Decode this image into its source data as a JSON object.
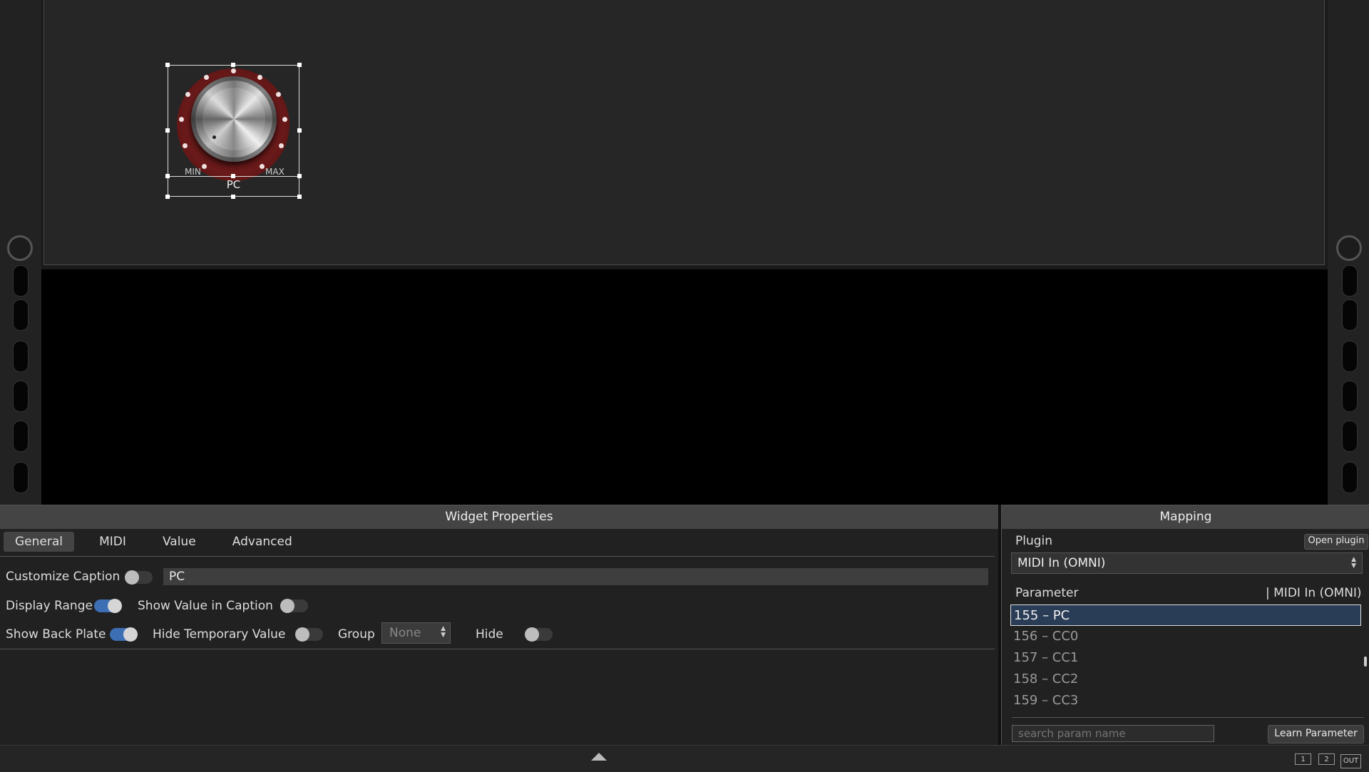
{
  "knob_widget": {
    "min_label": "MIN",
    "max_label": "MAX",
    "caption": "PC"
  },
  "widget_properties": {
    "title": "Widget Properties",
    "tabs": [
      "General",
      "MIDI",
      "Value",
      "Advanced"
    ],
    "active_tab": "General",
    "customize_caption_label": "Customize Caption",
    "customize_caption_on": false,
    "caption_value": "PC",
    "display_range_label": "Display Range",
    "display_range_on": true,
    "show_value_in_caption_label": "Show Value in Caption",
    "show_value_in_caption_on": false,
    "show_back_plate_label": "Show Back Plate",
    "show_back_plate_on": true,
    "hide_temporary_value_label": "Hide Temporary Value",
    "hide_temporary_value_on": false,
    "group_label": "Group",
    "group_value": "None",
    "hide_label": "Hide",
    "hide_on": false
  },
  "mapping": {
    "title": "Mapping",
    "plugin_label": "Plugin",
    "open_plugin_button": "Open plugin",
    "plugin_value": "MIDI In (OMNI)",
    "parameter_header": "Parameter",
    "parameter_plugin_header": "| MIDI In (OMNI)",
    "parameters": [
      "155 – PC",
      "156 – CC0",
      "157 – CC1",
      "158 – CC2",
      "159 – CC3"
    ],
    "selected_parameter": "155 – PC",
    "search_placeholder": "search param name",
    "learn_button": "Learn Parameter"
  },
  "statusbar": {
    "buttons": [
      "1",
      "2",
      "OUT"
    ]
  },
  "colors": {
    "toggle_on": "#3d6fb5",
    "selected_row": "#2a3d57",
    "knob_ring": "#6b1a1a"
  }
}
